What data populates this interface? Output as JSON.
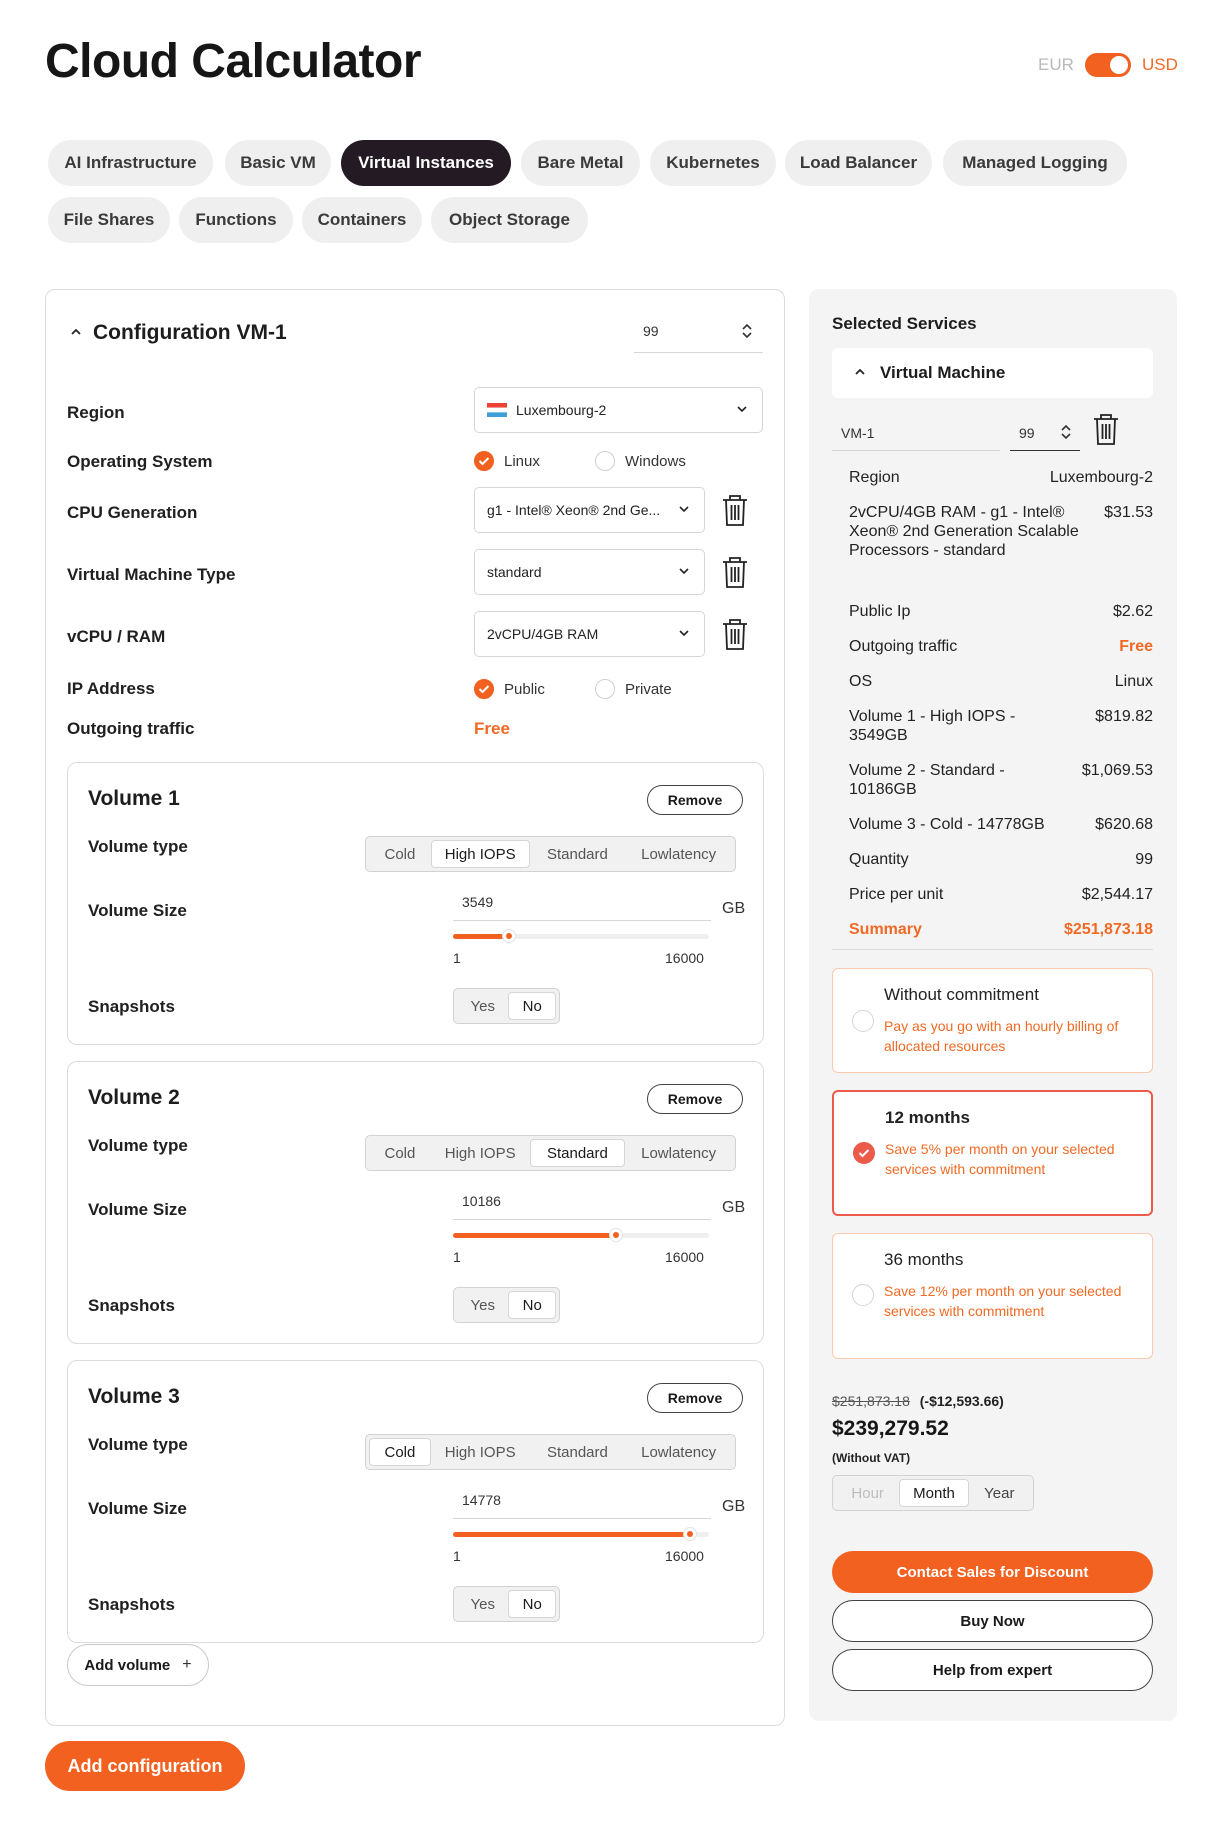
{
  "header": {
    "title": "Cloud Calculator",
    "currency_left": "EUR",
    "currency_right": "USD",
    "currency_selected": "USD"
  },
  "tabs": [
    {
      "label": "AI Infrastructure",
      "active": false
    },
    {
      "label": "Basic VM",
      "active": false
    },
    {
      "label": "Virtual Instances",
      "active": true
    },
    {
      "label": "Bare Metal",
      "active": false
    },
    {
      "label": "Kubernetes",
      "active": false
    },
    {
      "label": "Load Balancer",
      "active": false
    },
    {
      "label": "Managed Logging",
      "active": false
    },
    {
      "label": "File Shares",
      "active": false
    },
    {
      "label": "Functions",
      "active": false
    },
    {
      "label": "Containers",
      "active": false
    },
    {
      "label": "Object Storage",
      "active": false
    }
  ],
  "config": {
    "title": "Configuration VM-1",
    "quantity": "99",
    "region_label": "Region",
    "region_value": "Luxembourg-2",
    "os_label": "Operating System",
    "os_options": [
      "Linux",
      "Windows"
    ],
    "os_selected": "Linux",
    "cpu_label": "CPU Generation",
    "cpu_value": "g1 - Intel® Xeon® 2nd Ge...",
    "vm_type_label": "Virtual Machine Type",
    "vm_type_value": "standard",
    "vcpu_label": "vCPU / RAM",
    "vcpu_value": "2vCPU/4GB RAM",
    "ip_label": "IP Address",
    "ip_options": [
      "Public",
      "Private"
    ],
    "ip_selected": "Public",
    "traffic_label": "Outgoing traffic",
    "traffic_value": "Free",
    "volume_type_label": "Volume type",
    "volume_size_label": "Volume Size",
    "snapshots_label": "Snapshots",
    "remove_label": "Remove",
    "volume_types": [
      "Cold",
      "High IOPS",
      "Standard",
      "Lowlatency"
    ],
    "snapshot_options": [
      "Yes",
      "No"
    ],
    "size_unit": "GB",
    "size_min": "1",
    "size_max": "16000",
    "volumes": [
      {
        "title": "Volume 1",
        "type": "High IOPS",
        "size": "3549",
        "fill_fraction": 0.22,
        "snapshots": "No"
      },
      {
        "title": "Volume 2",
        "type": "Standard",
        "size": "10186",
        "fill_fraction": 0.637,
        "snapshots": "No"
      },
      {
        "title": "Volume 3",
        "type": "Cold",
        "size": "14778",
        "fill_fraction": 0.924,
        "snapshots": "No"
      }
    ],
    "add_volume_label": "Add volume",
    "add_volume_icon": "plus-icon"
  },
  "add_configuration_label": "Add configuration",
  "summary": {
    "heading": "Selected Services",
    "section_title": "Virtual Machine",
    "vm_name": "VM-1",
    "vm_quantity": "99",
    "rows": [
      {
        "key": "Region",
        "value": "Luxembourg-2"
      },
      {
        "key": "2vCPU/4GB RAM - g1 - Intel® Xeon® 2nd Generation Scalable Processors - standard",
        "value": "$31.53"
      },
      {
        "key": "Public Ip",
        "value": "$2.62"
      },
      {
        "key": "Outgoing traffic",
        "value": "Free"
      },
      {
        "key": "OS",
        "value": "Linux"
      },
      {
        "key": "Volume 1 - High IOPS - 3549GB",
        "value": "$819.82"
      },
      {
        "key": "Volume 2 - Standard - 10186GB",
        "value": "$1,069.53"
      },
      {
        "key": "Volume 3 - Cold - 14778GB",
        "value": "$620.68"
      },
      {
        "key": "Quantity",
        "value": "99"
      },
      {
        "key": "Price per unit",
        "value": "$2,544.17"
      },
      {
        "key": "Summary",
        "value": "$251,873.18"
      }
    ],
    "plans": [
      {
        "title": "Without commitment",
        "desc": "Pay as you go with an hourly billing of allocated resources",
        "selected": false
      },
      {
        "title": "12 months",
        "desc": "Save 5% per month on your selected services with commitment",
        "selected": true
      },
      {
        "title": "36 months",
        "desc": "Save 12% per month on your selected services with commitment",
        "selected": false
      }
    ],
    "old_price": "$251,873.18",
    "discount": "(-$12,593.66)",
    "total": "$239,279.52",
    "vat_note": "(Without VAT)",
    "periods": [
      "Hour",
      "Month",
      "Year"
    ],
    "period_selected": "Month",
    "contact_label": "Contact Sales for Discount",
    "buy_label": "Buy Now",
    "help_label": "Help from expert"
  },
  "colors": {
    "accent": "#f2611f",
    "dark_tab": "#231a23",
    "selected_plan_border": "#ec5a4a"
  }
}
